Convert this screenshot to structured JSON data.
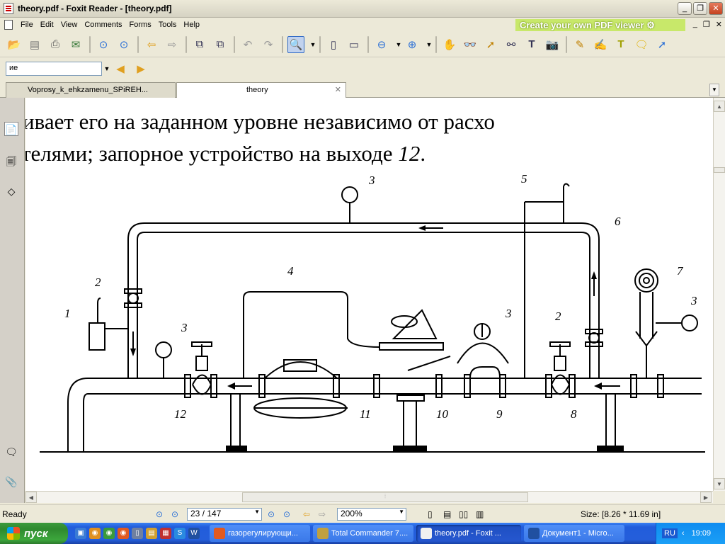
{
  "window": {
    "title": "theory.pdf - Foxit Reader - [theory.pdf]",
    "buttons": [
      "_",
      "❐",
      "✕"
    ]
  },
  "menu": {
    "items": [
      "File",
      "Edit",
      "View",
      "Comments",
      "Forms",
      "Tools",
      "Help"
    ],
    "promo": "Create your own PDF viewer",
    "mdi_buttons": [
      "_",
      "❐",
      "✕"
    ]
  },
  "find": {
    "value": "ие"
  },
  "tabs": [
    {
      "label": "Voprosy_k_ehkzamenu_SPiREH..."
    },
    {
      "label": "theory"
    }
  ],
  "document": {
    "line1": "ивает  его  на  заданном  уровне  независимо  от  расхо",
    "line2_start": "телями; запорное устройство на выходе ",
    "line2_num": "12",
    "line2_end": ".",
    "labels": [
      "1",
      "2",
      "3",
      "3",
      "3",
      "3",
      "4",
      "5",
      "6",
      "7",
      "2",
      "8",
      "9",
      "10",
      "11",
      "12"
    ]
  },
  "status": {
    "ready": "Ready",
    "page": "23 / 147",
    "zoom": "200%",
    "size": "Size: [8.26 * 11.69 in]"
  },
  "taskbar": {
    "start": "пуск",
    "tasks": [
      {
        "label": "газорегулирующи..."
      },
      {
        "label": "Total Commander 7...."
      },
      {
        "label": "theory.pdf - Foxit ..."
      },
      {
        "label": "Документ1 - Micro..."
      }
    ],
    "lang": "RU",
    "time": "19:09"
  },
  "colors": {
    "taskbar": "#245edb",
    "start": "#3ca63c",
    "promo": "#c8e86a",
    "promo_text": "#ffffff"
  }
}
